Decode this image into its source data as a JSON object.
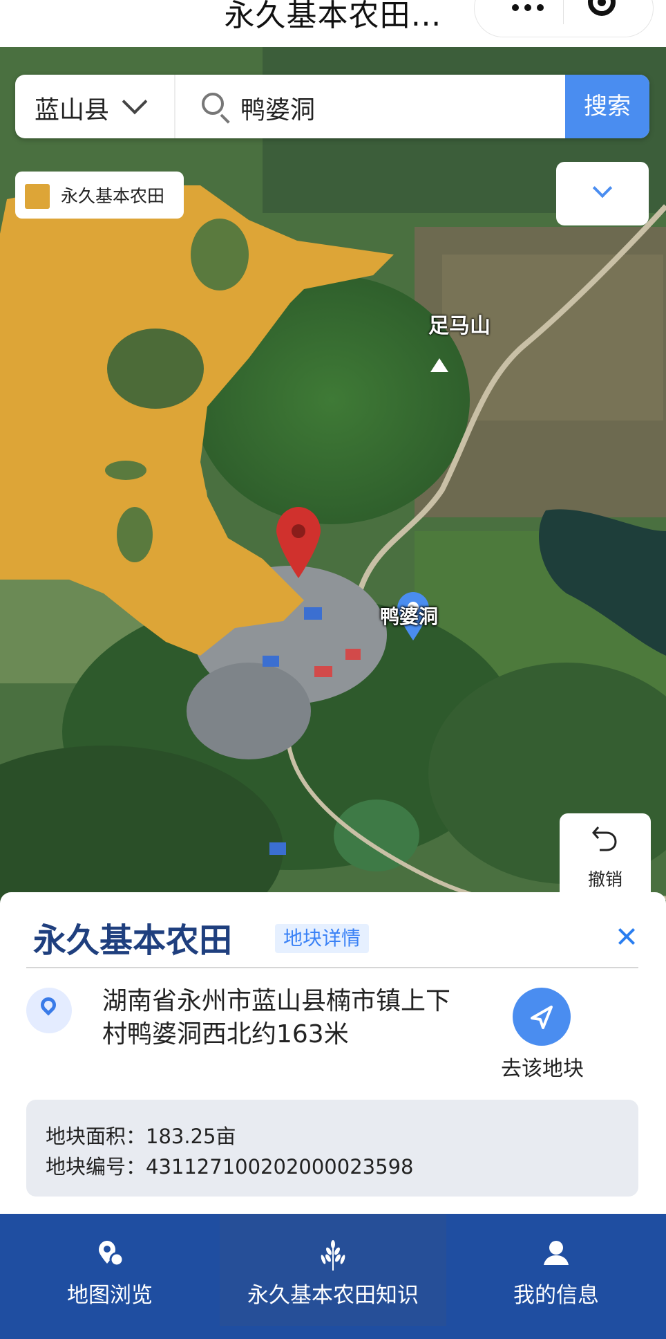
{
  "header": {
    "title": "永久基本农田…"
  },
  "search": {
    "county": "蓝山县",
    "keyword": "鸭婆洞",
    "button": "搜索"
  },
  "legend": {
    "label": "永久基本农田",
    "color": "#dda537"
  },
  "map_labels": {
    "peak": "足马山",
    "place": "鸭婆洞"
  },
  "controls": {
    "undo": "撤销"
  },
  "panel": {
    "title": "永久基本农田",
    "badge": "地块详情",
    "address": "湖南省永州市蓝山县楠市镇上下村鸭婆洞西北约163米",
    "go": "去该地块",
    "area": "地块面积：183.25亩",
    "code": "地块编号：431127100202000023598"
  },
  "nav": {
    "items": [
      {
        "label": "地图浏览",
        "icon": "map-pin-icon"
      },
      {
        "label": "永久基本农田知识",
        "icon": "wheat-icon"
      },
      {
        "label": "我的信息",
        "icon": "user-icon"
      }
    ]
  },
  "colors": {
    "accent": "#4a8df0",
    "nav_bg": "#1f4ea1",
    "title": "#1f3f7e",
    "farmland": "#dda537",
    "pin_red": "#d0312d"
  }
}
